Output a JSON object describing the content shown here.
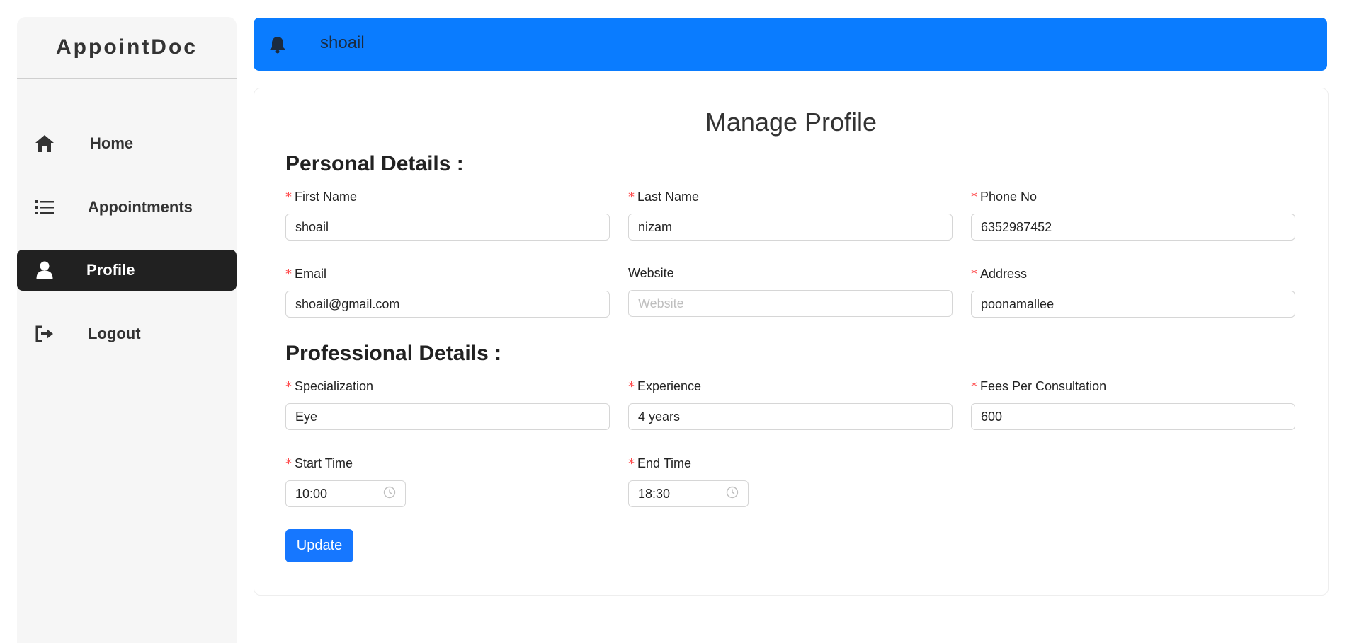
{
  "app": {
    "brand": "AppointDoc"
  },
  "sidebar": {
    "items": [
      {
        "label": "Home",
        "icon": "home-icon"
      },
      {
        "label": "Appointments",
        "icon": "list-icon"
      },
      {
        "label": "Profile",
        "icon": "user-icon",
        "active": true
      },
      {
        "label": "Logout",
        "icon": "logout-icon"
      }
    ]
  },
  "header": {
    "user": "shoail",
    "icon": "bell-icon",
    "color": "#0a7cff"
  },
  "form": {
    "title": "Manage Profile",
    "personal_heading": "Personal Details :",
    "professional_heading": "Professional Details :",
    "fields": {
      "first_name": {
        "label": "First Name",
        "value": "shoail",
        "required": true
      },
      "last_name": {
        "label": "Last Name",
        "value": "nizam",
        "required": true
      },
      "phone": {
        "label": "Phone No",
        "value": "6352987452",
        "required": true
      },
      "email": {
        "label": "Email",
        "value": "shoail@gmail.com",
        "required": true
      },
      "website": {
        "label": "Website",
        "value": "",
        "placeholder": "Website",
        "required": false
      },
      "address": {
        "label": "Address",
        "value": "poonamallee",
        "required": true
      },
      "specialization": {
        "label": "Specialization",
        "value": "Eye",
        "required": true
      },
      "experience": {
        "label": "Experience",
        "value": "4 years",
        "required": true
      },
      "fees": {
        "label": "Fees Per Consultation",
        "value": "600",
        "required": true
      },
      "start_time": {
        "label": "Start Time",
        "value": "10:00",
        "required": true
      },
      "end_time": {
        "label": "End Time",
        "value": "18:30",
        "required": true
      }
    },
    "required_mark": "*",
    "submit_label": "Update",
    "accent": "#1677ff"
  }
}
